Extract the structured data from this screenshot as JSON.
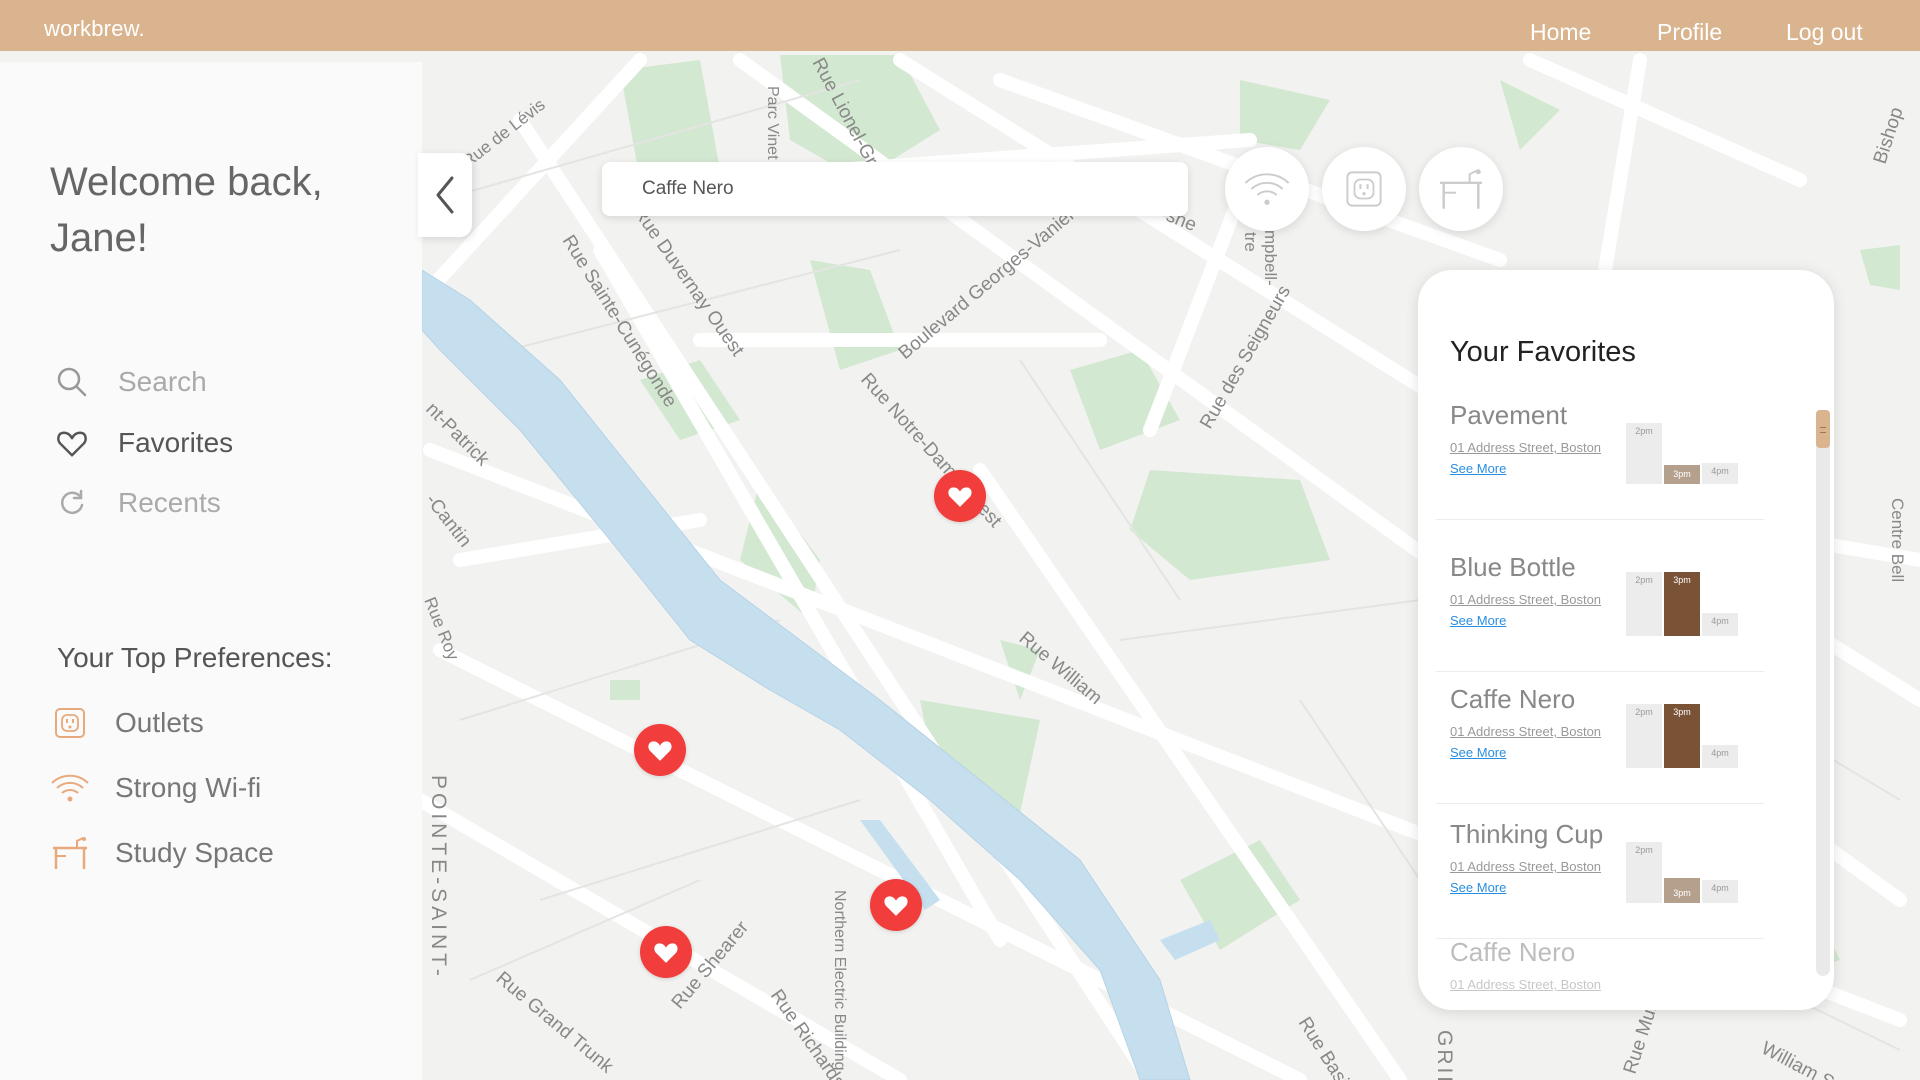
{
  "app": {
    "brand": "workbrew."
  },
  "nav": {
    "home": "Home",
    "profile": "Profile",
    "logout": "Log out"
  },
  "sidebar": {
    "welcome": "Welcome back, Jane!",
    "menu": [
      {
        "label": "Search",
        "icon": "search-icon",
        "active": false
      },
      {
        "label": "Favorites",
        "icon": "heart-icon",
        "active": true
      },
      {
        "label": "Recents",
        "icon": "refresh-icon",
        "active": false
      }
    ],
    "prefs_heading": "Your Top Preferences:",
    "prefs": [
      {
        "label": "Outlets",
        "icon": "outlet-icon"
      },
      {
        "label": "Strong Wi-fi",
        "icon": "wifi-icon"
      },
      {
        "label": "Study Space",
        "icon": "desk-icon"
      }
    ]
  },
  "search": {
    "value": "Caffe Nero"
  },
  "filters": [
    "wifi-icon",
    "outlet-icon",
    "desk-icon"
  ],
  "map_labels": {
    "l1": "Rue Notre-Dame Ouest",
    "l2": "Rue Sainte-Cunégonde",
    "l3": "Boulevard Georges-Vanier",
    "l4": "Rue William",
    "l5": "Rue des Seigneurs",
    "l6": "Rue Duvernay Ouest",
    "l7": "POINTE-SAINT-",
    "l8": "Rue Grand Trunk",
    "l9": "Rue Shearer",
    "l10": "Rue Richardson",
    "l11": "Northern Electric Building",
    "l12": "Centre Bell",
    "l13": "Rue Lionel-Groulx",
    "l14": "Parc Vinet",
    "l15": "nt-Patrick",
    "l16": "Rue de Lévis",
    "l17": "Rue Basin",
    "l18": "William S",
    "l19": "Rue Murray",
    "l20": "GRIF",
    "l21": "Bishop",
    "l22": "sne",
    "l23": "-Cantin",
    "l24": "Rue Roy",
    "l25": "mpbell-",
    "l26": "tre"
  },
  "favorites": {
    "title": "Your Favorites",
    "items": [
      {
        "name": "Pavement",
        "address": "01 Address Street, Boston",
        "more": "See More",
        "chart": {
          "left_label": "2pm",
          "mid_label": "3pm",
          "right_label": "4pm",
          "left": 0.8,
          "mid": 0.25,
          "right": 0.28,
          "mid_color": "#b5a08e"
        }
      },
      {
        "name": "Blue Bottle",
        "address": "01 Address Street, Boston",
        "more": "See More",
        "chart": {
          "left_label": "2pm",
          "mid_label": "3pm",
          "right_label": "4pm",
          "left": 0.84,
          "mid": 0.84,
          "right": 0.3,
          "mid_color": "#7a5236"
        }
      },
      {
        "name": "Caffe Nero",
        "address": "01 Address Street, Boston",
        "more": "See More",
        "chart": {
          "left_label": "2pm",
          "mid_label": "3pm",
          "right_label": "4pm",
          "left": 0.84,
          "mid": 0.84,
          "right": 0.3,
          "mid_color": "#7a5236"
        }
      },
      {
        "name": "Thinking Cup",
        "address": "01 Address Street, Boston",
        "more": "See More",
        "chart": {
          "left_label": "2pm",
          "mid_label": "3pm",
          "right_label": "4pm",
          "left": 0.8,
          "mid": 0.33,
          "right": 0.3,
          "mid_color": "#b5a08e"
        }
      },
      {
        "name": "Caffe Nero",
        "address": "01 Address Street, Boston",
        "more": "",
        "chart": null
      }
    ]
  },
  "colors": {
    "brand": "#d9b48f",
    "pin": "#f23d3d",
    "water": "#c6dfef",
    "park": "#d3e8d1",
    "link": "#2a8ee0"
  }
}
